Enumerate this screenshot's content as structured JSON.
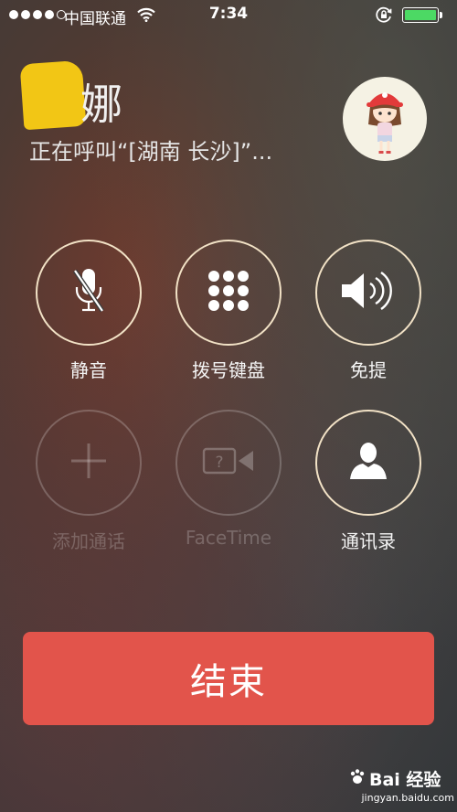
{
  "status_bar": {
    "carrier": "中国联通",
    "time": "7:34",
    "battery_level": 1.0,
    "battery_color": "#4cd964",
    "signal_bars": 4
  },
  "call": {
    "caller_name": "娜",
    "status": "正在呼叫“[湖南 长沙]”..."
  },
  "buttons": {
    "mute": {
      "label": "静音",
      "icon": "mic-off-icon",
      "enabled": true
    },
    "keypad": {
      "label": "拨号键盘",
      "icon": "keypad-icon",
      "enabled": true
    },
    "speaker": {
      "label": "免提",
      "icon": "speaker-icon",
      "enabled": true
    },
    "add_call": {
      "label": "添加通话",
      "icon": "plus-icon",
      "enabled": false
    },
    "facetime": {
      "label": "FaceTime",
      "icon": "facetime-icon",
      "enabled": false
    },
    "contacts": {
      "label": "通讯录",
      "icon": "contact-icon",
      "enabled": true
    }
  },
  "end_call": {
    "label": "结束",
    "color": "#e2544b"
  },
  "watermark": {
    "brand": "Bai 经验",
    "url": "jingyan.baidu.com"
  }
}
